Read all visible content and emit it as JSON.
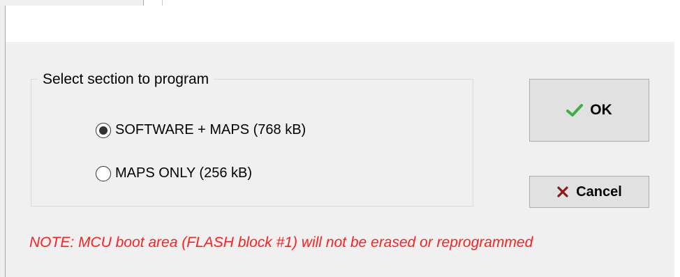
{
  "group": {
    "title": "Select section to program"
  },
  "options": {
    "software_maps": {
      "label": "SOFTWARE + MAPS (768 kB)",
      "selected": true
    },
    "maps_only": {
      "label": "MAPS ONLY (256 kB)",
      "selected": false
    }
  },
  "buttons": {
    "ok": {
      "label": "OK",
      "icon": "checkmark-icon"
    },
    "cancel": {
      "label": "Cancel",
      "icon": "x-icon"
    }
  },
  "note": "NOTE: MCU boot area (FLASH block #1) will not be erased or reprogrammed",
  "colors": {
    "note": "#ff2020",
    "check": "#3cb043",
    "cross": "#8b1a1a",
    "dialog_bg": "#f0f0f0"
  }
}
